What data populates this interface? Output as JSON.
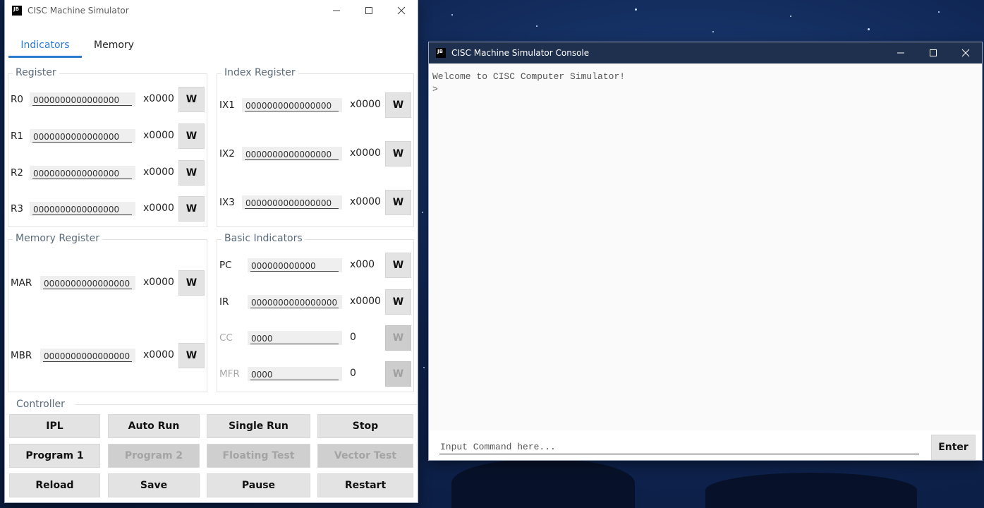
{
  "simulator": {
    "title": "CISC Machine Simulator",
    "logo": "JB",
    "tabs": [
      {
        "label": "Indicators",
        "active": true
      },
      {
        "label": "Memory",
        "active": false
      }
    ],
    "register": {
      "title": "Register",
      "rows": [
        {
          "label": "R0",
          "value": "0000000000000000",
          "hex": "x0000",
          "button": "W"
        },
        {
          "label": "R1",
          "value": "0000000000000000",
          "hex": "x0000",
          "button": "W"
        },
        {
          "label": "R2",
          "value": "0000000000000000",
          "hex": "x0000",
          "button": "W"
        },
        {
          "label": "R3",
          "value": "0000000000000000",
          "hex": "x0000",
          "button": "W"
        }
      ]
    },
    "index_register": {
      "title": "Index Register",
      "rows": [
        {
          "label": "IX1",
          "value": "0000000000000000",
          "hex": "x0000",
          "button": "W"
        },
        {
          "label": "IX2",
          "value": "0000000000000000",
          "hex": "x0000",
          "button": "W"
        },
        {
          "label": "IX3",
          "value": "0000000000000000",
          "hex": "x0000",
          "button": "W"
        }
      ]
    },
    "memory_register": {
      "title": "Memory Register",
      "rows": [
        {
          "label": "MAR",
          "value": "0000000000000000",
          "hex": "x0000",
          "button": "W"
        },
        {
          "label": "MBR",
          "value": "0000000000000000",
          "hex": "x0000",
          "button": "W"
        }
      ]
    },
    "basic_indicators": {
      "title": "Basic Indicators",
      "rows": [
        {
          "label": "PC",
          "value": "000000000000",
          "hex": "x000",
          "button": "W",
          "enabled": true
        },
        {
          "label": "IR",
          "value": "0000000000000000",
          "hex": "x0000",
          "button": "W",
          "enabled": true
        },
        {
          "label": "CC",
          "value": "0000",
          "hex": "0",
          "button": "W",
          "enabled": false
        },
        {
          "label": "MFR",
          "value": "0000",
          "hex": "0",
          "button": "W",
          "enabled": false
        }
      ]
    },
    "controller": {
      "title": "Controller",
      "buttons": [
        {
          "label": "IPL",
          "enabled": true
        },
        {
          "label": "Auto Run",
          "enabled": true
        },
        {
          "label": "Single Run",
          "enabled": true
        },
        {
          "label": "Stop",
          "enabled": true
        },
        {
          "label": "Program 1",
          "enabled": true
        },
        {
          "label": "Program 2",
          "enabled": false
        },
        {
          "label": "Floating Test",
          "enabled": false
        },
        {
          "label": "Vector Test",
          "enabled": false
        },
        {
          "label": "Reload",
          "enabled": true
        },
        {
          "label": "Save",
          "enabled": true
        },
        {
          "label": "Pause",
          "enabled": true
        },
        {
          "label": "Restart",
          "enabled": true
        }
      ]
    }
  },
  "console": {
    "title": "CISC Machine Simulator Console",
    "logo": "JB",
    "output_lines": [
      "Welcome to CISC Computer Simulator!",
      ">"
    ],
    "input_placeholder": "Input Command here...",
    "enter_label": "Enter",
    "title_bar_color": "#1f2f4e"
  },
  "colors": {
    "accent": "#2a7ad0",
    "desktop": "#0f2552"
  }
}
